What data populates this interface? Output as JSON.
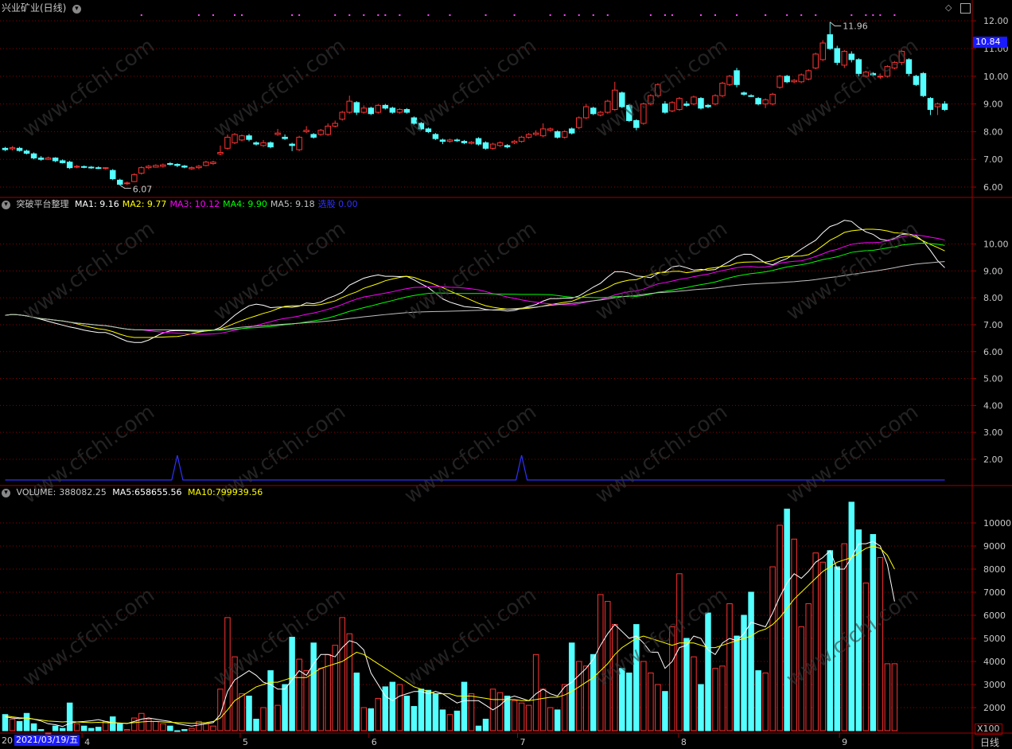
{
  "title": "兴业矿业(日线)",
  "period_label": "日线",
  "x100_label": "X100",
  "colors": {
    "up": "#ff3232",
    "down": "#54ffff",
    "grid": "#8b0000",
    "frame": "#a00000",
    "axis_text": "#c8c8c8",
    "ma1": "#ffffff",
    "ma2": "#ffff00",
    "ma3": "#ff00ff",
    "ma4": "#00ff00",
    "ma5": "#c0c0c0",
    "signal": "#3030ff",
    "dots": "#ff44ff",
    "current_price_bg": "#1a1aff"
  },
  "price_panel": {
    "y_ticks": [
      "12.00",
      "11.00",
      "10.00",
      "9.00",
      "8.00",
      "7.00",
      "6.00"
    ],
    "current_price": "10.84",
    "high_label": "11.96",
    "low_label": "6.07"
  },
  "indicator_panel": {
    "name": "突破平台整理",
    "ma_labels": [
      {
        "name": "MA1:",
        "value": "9.16",
        "color": "#ffffff"
      },
      {
        "name": "MA2:",
        "value": "9.77",
        "color": "#ffff00"
      },
      {
        "name": "MA3:",
        "value": "10.12",
        "color": "#ff00ff"
      },
      {
        "name": "MA4:",
        "value": "9.90",
        "color": "#00ff00"
      },
      {
        "name": "MA5:",
        "value": "9.18",
        "color": "#c0c0c0"
      },
      {
        "name": "选股",
        "value": "0.00",
        "color": "#3030ff"
      }
    ],
    "y_ticks": [
      "10.00",
      "9.00",
      "8.00",
      "7.00",
      "6.00",
      "5.00",
      "4.00",
      "3.00",
      "2.00"
    ]
  },
  "volume_panel": {
    "label": "VOLUME:",
    "value": "388082.25",
    "ma5_label": "MA5:",
    "ma5_value": "658655.56",
    "ma10_label": "MA10:",
    "ma10_value": "799939.56",
    "y_ticks": [
      "10000",
      "9000",
      "8000",
      "7000",
      "6000",
      "5000",
      "4000",
      "3000",
      "2000"
    ]
  },
  "x_axis": {
    "first_date": "2021/03/19/五",
    "prefix": "20",
    "month_labels": [
      "4",
      "5",
      "6",
      "7",
      "8",
      "9"
    ]
  },
  "chart_data": {
    "type": "candlestick",
    "title": "兴业矿业(日线)",
    "price_range": [
      5.8,
      12.35
    ],
    "candles": [
      {
        "o": 7.4,
        "c": 7.35,
        "h": 7.45,
        "l": 7.3
      },
      {
        "o": 7.38,
        "c": 7.42,
        "h": 7.48,
        "l": 7.32
      },
      {
        "o": 7.4,
        "c": 7.32,
        "h": 7.45,
        "l": 7.28
      },
      {
        "o": 7.3,
        "c": 7.22,
        "h": 7.35,
        "l": 7.18
      },
      {
        "o": 7.2,
        "c": 7.05,
        "h": 7.25,
        "l": 7.0
      },
      {
        "o": 7.05,
        "c": 7.0,
        "h": 7.12,
        "l": 6.95
      },
      {
        "o": 7.0,
        "c": 7.05,
        "h": 7.1,
        "l": 6.98
      },
      {
        "o": 7.05,
        "c": 6.95,
        "h": 7.08,
        "l": 6.9
      },
      {
        "o": 6.95,
        "c": 6.88,
        "h": 7.0,
        "l": 6.85
      },
      {
        "o": 6.9,
        "c": 6.7,
        "h": 6.95,
        "l": 6.65
      },
      {
        "o": 6.72,
        "c": 6.75,
        "h": 6.8,
        "l": 6.68
      },
      {
        "o": 6.74,
        "c": 6.72,
        "h": 6.78,
        "l": 6.68
      },
      {
        "o": 6.72,
        "c": 6.7,
        "h": 6.76,
        "l": 6.66
      },
      {
        "o": 6.7,
        "c": 6.68,
        "h": 6.75,
        "l": 6.65
      },
      {
        "o": 6.68,
        "c": 6.7,
        "h": 6.72,
        "l": 6.63
      },
      {
        "o": 6.6,
        "c": 6.3,
        "h": 6.65,
        "l": 6.25
      },
      {
        "o": 6.25,
        "c": 6.1,
        "h": 6.3,
        "l": 6.07
      },
      {
        "o": 6.12,
        "c": 6.15,
        "h": 6.2,
        "l": 6.08
      },
      {
        "o": 6.2,
        "c": 6.45,
        "h": 6.5,
        "l": 6.18
      },
      {
        "o": 6.5,
        "c": 6.7,
        "h": 6.75,
        "l": 6.45
      },
      {
        "o": 6.7,
        "c": 6.75,
        "h": 6.8,
        "l": 6.65
      },
      {
        "o": 6.72,
        "c": 6.78,
        "h": 6.82,
        "l": 6.7
      },
      {
        "o": 6.75,
        "c": 6.8,
        "h": 6.85,
        "l": 6.7
      },
      {
        "o": 6.85,
        "c": 6.82,
        "h": 6.9,
        "l": 6.78
      },
      {
        "o": 6.82,
        "c": 6.78,
        "h": 6.86,
        "l": 6.72
      },
      {
        "o": 6.76,
        "c": 6.72,
        "h": 6.8,
        "l": 6.68
      },
      {
        "o": 6.66,
        "c": 6.7,
        "h": 6.75,
        "l": 6.62
      },
      {
        "o": 6.7,
        "c": 6.75,
        "h": 6.8,
        "l": 6.65
      },
      {
        "o": 6.78,
        "c": 6.9,
        "h": 6.95,
        "l": 6.75
      },
      {
        "o": 6.85,
        "c": 6.9,
        "h": 6.95,
        "l": 6.8
      },
      {
        "o": 7.2,
        "c": 7.25,
        "h": 7.5,
        "l": 7.15
      },
      {
        "o": 7.4,
        "c": 7.8,
        "h": 7.9,
        "l": 7.35
      },
      {
        "o": 7.6,
        "c": 7.9,
        "h": 7.95,
        "l": 7.55
      },
      {
        "o": 7.7,
        "c": 7.85,
        "h": 7.9,
        "l": 7.65
      },
      {
        "o": 7.85,
        "c": 7.72,
        "h": 7.92,
        "l": 7.65
      },
      {
        "o": 7.6,
        "c": 7.55,
        "h": 7.65,
        "l": 7.5
      },
      {
        "o": 7.5,
        "c": 7.6,
        "h": 7.7,
        "l": 7.45
      },
      {
        "o": 7.6,
        "c": 7.45,
        "h": 7.65,
        "l": 7.4
      },
      {
        "o": 7.9,
        "c": 7.95,
        "h": 8.1,
        "l": 7.85
      },
      {
        "o": 7.8,
        "c": 7.75,
        "h": 7.9,
        "l": 7.7
      },
      {
        "o": 7.55,
        "c": 7.5,
        "h": 7.6,
        "l": 7.3
      },
      {
        "o": 7.35,
        "c": 7.8,
        "h": 7.85,
        "l": 7.3
      },
      {
        "o": 8.0,
        "c": 8.05,
        "h": 8.2,
        "l": 7.95
      },
      {
        "o": 7.9,
        "c": 7.8,
        "h": 7.95,
        "l": 7.75
      },
      {
        "o": 7.9,
        "c": 8.05,
        "h": 8.1,
        "l": 7.85
      },
      {
        "o": 7.9,
        "c": 8.2,
        "h": 8.3,
        "l": 7.85
      },
      {
        "o": 8.2,
        "c": 8.3,
        "h": 8.4,
        "l": 8.15
      },
      {
        "o": 8.45,
        "c": 8.7,
        "h": 8.75,
        "l": 8.4
      },
      {
        "o": 8.7,
        "c": 9.1,
        "h": 9.3,
        "l": 8.65
      },
      {
        "o": 9.05,
        "c": 8.7,
        "h": 9.1,
        "l": 8.6
      },
      {
        "o": 8.7,
        "c": 8.85,
        "h": 8.95,
        "l": 8.65
      },
      {
        "o": 8.85,
        "c": 8.65,
        "h": 8.9,
        "l": 8.6
      },
      {
        "o": 8.7,
        "c": 8.95,
        "h": 9.0,
        "l": 8.65
      },
      {
        "o": 8.95,
        "c": 8.85,
        "h": 9.0,
        "l": 8.8
      },
      {
        "o": 8.85,
        "c": 8.7,
        "h": 8.9,
        "l": 8.65
      },
      {
        "o": 8.7,
        "c": 8.8,
        "h": 8.85,
        "l": 8.65
      },
      {
        "o": 8.8,
        "c": 8.7,
        "h": 8.85,
        "l": 8.65
      },
      {
        "o": 8.5,
        "c": 8.3,
        "h": 8.55,
        "l": 8.25
      },
      {
        "o": 8.3,
        "c": 8.1,
        "h": 8.35,
        "l": 8.05
      },
      {
        "o": 8.1,
        "c": 8.0,
        "h": 8.15,
        "l": 7.95
      },
      {
        "o": 7.9,
        "c": 7.75,
        "h": 7.95,
        "l": 7.7
      },
      {
        "o": 7.7,
        "c": 7.65,
        "h": 7.75,
        "l": 7.55
      },
      {
        "o": 7.65,
        "c": 7.7,
        "h": 7.75,
        "l": 7.6
      },
      {
        "o": 7.7,
        "c": 7.68,
        "h": 7.75,
        "l": 7.63
      },
      {
        "o": 7.65,
        "c": 7.6,
        "h": 7.7,
        "l": 7.55
      },
      {
        "o": 7.58,
        "c": 7.62,
        "h": 7.66,
        "l": 7.54
      },
      {
        "o": 7.75,
        "c": 7.55,
        "h": 7.8,
        "l": 7.5
      },
      {
        "o": 7.6,
        "c": 7.4,
        "h": 7.65,
        "l": 7.35
      },
      {
        "o": 7.4,
        "c": 7.55,
        "h": 7.6,
        "l": 7.35
      },
      {
        "o": 7.5,
        "c": 7.6,
        "h": 7.65,
        "l": 7.45
      },
      {
        "o": 7.5,
        "c": 7.45,
        "h": 7.55,
        "l": 7.4
      },
      {
        "o": 7.6,
        "c": 7.65,
        "h": 7.7,
        "l": 7.55
      },
      {
        "o": 7.65,
        "c": 7.8,
        "h": 7.85,
        "l": 7.6
      },
      {
        "o": 7.8,
        "c": 7.9,
        "h": 7.95,
        "l": 7.75
      },
      {
        "o": 7.9,
        "c": 7.95,
        "h": 8.05,
        "l": 7.85
      },
      {
        "o": 7.85,
        "c": 8.1,
        "h": 8.3,
        "l": 7.8
      },
      {
        "o": 8.05,
        "c": 8.1,
        "h": 8.15,
        "l": 8.0
      },
      {
        "o": 8.0,
        "c": 7.8,
        "h": 8.05,
        "l": 7.75
      },
      {
        "o": 7.8,
        "c": 8.0,
        "h": 8.05,
        "l": 7.75
      },
      {
        "o": 8.1,
        "c": 7.95,
        "h": 8.15,
        "l": 7.9
      },
      {
        "o": 8.15,
        "c": 8.5,
        "h": 8.55,
        "l": 8.1
      },
      {
        "o": 8.5,
        "c": 8.9,
        "h": 9.0,
        "l": 8.45
      },
      {
        "o": 8.85,
        "c": 8.65,
        "h": 8.9,
        "l": 8.6
      },
      {
        "o": 8.6,
        "c": 8.7,
        "h": 8.75,
        "l": 8.55
      },
      {
        "o": 8.7,
        "c": 9.1,
        "h": 9.15,
        "l": 8.65
      },
      {
        "o": 8.8,
        "c": 9.5,
        "h": 9.8,
        "l": 8.75
      },
      {
        "o": 9.4,
        "c": 8.9,
        "h": 9.45,
        "l": 8.85
      },
      {
        "o": 8.95,
        "c": 8.4,
        "h": 9.0,
        "l": 8.35
      },
      {
        "o": 8.4,
        "c": 8.15,
        "h": 8.45,
        "l": 8.05
      },
      {
        "o": 8.3,
        "c": 9.0,
        "h": 9.05,
        "l": 8.25
      },
      {
        "o": 9.0,
        "c": 9.3,
        "h": 9.35,
        "l": 8.95
      },
      {
        "o": 9.3,
        "c": 9.7,
        "h": 9.75,
        "l": 9.25
      },
      {
        "o": 9.0,
        "c": 8.7,
        "h": 9.1,
        "l": 8.65
      },
      {
        "o": 8.75,
        "c": 9.05,
        "h": 9.1,
        "l": 8.7
      },
      {
        "o": 8.8,
        "c": 9.2,
        "h": 9.25,
        "l": 8.75
      },
      {
        "o": 9.0,
        "c": 8.95,
        "h": 9.1,
        "l": 8.9
      },
      {
        "o": 9.0,
        "c": 9.25,
        "h": 9.3,
        "l": 8.95
      },
      {
        "o": 9.2,
        "c": 8.85,
        "h": 9.25,
        "l": 8.8
      },
      {
        "o": 8.95,
        "c": 8.9,
        "h": 9.0,
        "l": 8.85
      },
      {
        "o": 9.0,
        "c": 9.3,
        "h": 9.35,
        "l": 8.95
      },
      {
        "o": 9.3,
        "c": 9.75,
        "h": 9.8,
        "l": 9.25
      },
      {
        "o": 9.7,
        "c": 10.0,
        "h": 10.05,
        "l": 9.65
      },
      {
        "o": 10.2,
        "c": 9.7,
        "h": 10.3,
        "l": 9.6
      },
      {
        "o": 9.4,
        "c": 9.35,
        "h": 9.45,
        "l": 9.3
      },
      {
        "o": 9.3,
        "c": 9.28,
        "h": 9.35,
        "l": 9.25
      },
      {
        "o": 9.2,
        "c": 9.0,
        "h": 9.25,
        "l": 8.95
      },
      {
        "o": 9.0,
        "c": 9.15,
        "h": 9.2,
        "l": 8.85
      },
      {
        "o": 9.0,
        "c": 9.35,
        "h": 9.4,
        "l": 8.95
      },
      {
        "o": 9.6,
        "c": 10.0,
        "h": 10.05,
        "l": 9.55
      },
      {
        "o": 10.0,
        "c": 9.8,
        "h": 10.05,
        "l": 9.75
      },
      {
        "o": 9.8,
        "c": 9.85,
        "h": 9.9,
        "l": 9.75
      },
      {
        "o": 9.8,
        "c": 10.05,
        "h": 10.1,
        "l": 9.75
      },
      {
        "o": 9.9,
        "c": 10.2,
        "h": 10.25,
        "l": 9.85
      },
      {
        "o": 10.3,
        "c": 10.8,
        "h": 10.85,
        "l": 10.25
      },
      {
        "o": 10.6,
        "c": 11.2,
        "h": 11.3,
        "l": 10.55
      },
      {
        "o": 11.5,
        "c": 11.0,
        "h": 11.96,
        "l": 10.95
      },
      {
        "o": 11.0,
        "c": 10.5,
        "h": 11.1,
        "l": 10.4
      },
      {
        "o": 10.4,
        "c": 10.9,
        "h": 10.95,
        "l": 10.3
      },
      {
        "o": 10.8,
        "c": 10.6,
        "h": 10.9,
        "l": 10.5
      },
      {
        "o": 10.6,
        "c": 10.1,
        "h": 10.65,
        "l": 10.0
      },
      {
        "o": 10.0,
        "c": 10.15,
        "h": 10.2,
        "l": 9.95
      },
      {
        "o": 10.1,
        "c": 10.05,
        "h": 10.15,
        "l": 10.0
      },
      {
        "o": 10.0,
        "c": 10.0,
        "h": 10.1,
        "l": 9.9
      },
      {
        "o": 10.0,
        "c": 10.35,
        "h": 10.4,
        "l": 9.95
      },
      {
        "o": 10.3,
        "c": 10.5,
        "h": 10.55,
        "l": 10.25
      },
      {
        "o": 10.5,
        "c": 10.9,
        "h": 10.95,
        "l": 10.4
      },
      {
        "o": 10.6,
        "c": 10.1,
        "h": 10.65,
        "l": 10.0
      },
      {
        "o": 10.0,
        "c": 9.7,
        "h": 10.05,
        "l": 9.65
      },
      {
        "o": 10.1,
        "c": 9.3,
        "h": 10.15,
        "l": 9.25
      },
      {
        "o": 9.2,
        "c": 8.8,
        "h": 9.25,
        "l": 8.6
      },
      {
        "o": 8.9,
        "c": 9.0,
        "h": 9.05,
        "l": 8.6
      },
      {
        "o": 9.0,
        "c": 8.8,
        "h": 9.1,
        "l": 8.75
      }
    ],
    "volume_range": [
      1000,
      11000
    ],
    "volumes": [
      1700,
      1500,
      1400,
      1750,
      1300,
      1050,
      900,
      1200,
      1100,
      2200,
      1300,
      1200,
      1100,
      1150,
      1400,
      1600,
      1300,
      1050,
      1550,
      1750,
      1500,
      1400,
      1300,
      1200,
      1000,
      1050,
      1100,
      1400,
      1300,
      1200,
      2800,
      5900,
      4200,
      2600,
      2500,
      1500,
      2000,
      3600,
      2100,
      3000,
      5050,
      4100,
      3600,
      4800,
      3700,
      4300,
      4700,
      5900,
      5200,
      3500,
      2000,
      1950,
      2400,
      2900,
      3100,
      3000,
      2500,
      2050,
      2800,
      2750,
      2600,
      1900,
      1700,
      1850,
      3100,
      2600,
      1200,
      1500,
      2800,
      2650,
      2500,
      2300,
      2200,
      2100,
      4300,
      2800,
      2000,
      1900,
      3000,
      4800,
      4000,
      3800,
      4300,
      6900,
      6600,
      5600,
      3700,
      3500,
      5600,
      4000,
      3500,
      3000,
      2700,
      5500,
      7800,
      5000,
      4200,
      3000,
      6100,
      3700,
      3800,
      6500,
      5100,
      6000,
      7000,
      3600,
      3500,
      8100,
      9900,
      10600,
      9300,
      5500,
      6500,
      8700,
      8300,
      8800,
      8100,
      9100,
      10900,
      9700,
      7400,
      9500,
      8500,
      3900,
      3900
    ],
    "vol_ma5": [
      1600,
      1550,
      1520,
      1560,
      1500,
      1420,
      1300,
      1260,
      1180,
      1320,
      1380,
      1400,
      1430,
      1480,
      1400,
      1350,
      1330,
      1310,
      1400,
      1500,
      1550,
      1500,
      1450,
      1400,
      1300,
      1250,
      1200,
      1250,
      1300,
      1350,
      1700,
      2700,
      3200,
      3400,
      3600,
      3400,
      3100,
      3000,
      2800,
      2800,
      3200,
      3600,
      3400,
      3900,
      4300,
      4300,
      4200,
      4600,
      4900,
      4800,
      4500,
      3500,
      3000,
      2500,
      2300,
      2500,
      2600,
      2700,
      2700,
      2600,
      2700,
      2600,
      2400,
      2200,
      2300,
      2300,
      2300,
      2100,
      1900,
      2100,
      2400,
      2500,
      2400,
      2300,
      2600,
      2800,
      2600,
      2500,
      2900,
      3100,
      3400,
      3700,
      4100,
      4700,
      5200,
      5600,
      5300,
      5000,
      5100,
      4800,
      4400,
      4400,
      3700,
      4000,
      4600,
      4700,
      5100,
      5000,
      4500,
      4300,
      4800,
      5000,
      4900,
      5200,
      5700,
      5600,
      5500,
      6100,
      6800,
      7400,
      7800,
      7600,
      7900,
      8300,
      8500,
      8800,
      8000,
      8000,
      8500,
      9100,
      9100,
      9200,
      9000,
      8200,
      6600
    ],
    "vol_ma10": [
      1650,
      1600,
      1560,
      1540,
      1500,
      1460,
      1420,
      1400,
      1380,
      1400,
      1380,
      1360,
      1350,
      1360,
      1350,
      1340,
      1330,
      1320,
      1350,
      1380,
      1400,
      1400,
      1380,
      1360,
      1350,
      1340,
      1320,
      1330,
      1350,
      1400,
      1550,
      1900,
      2300,
      2500,
      2700,
      2900,
      3000,
      3100,
      3100,
      3200,
      3300,
      3300,
      3300,
      3500,
      3700,
      3800,
      3900,
      4000,
      4200,
      4400,
      4300,
      4100,
      3900,
      3700,
      3500,
      3300,
      3100,
      2900,
      2800,
      2700,
      2600,
      2600,
      2600,
      2500,
      2500,
      2500,
      2450,
      2400,
      2350,
      2350,
      2350,
      2350,
      2300,
      2300,
      2350,
      2400,
      2450,
      2450,
      2550,
      2700,
      2900,
      3100,
      3300,
      3600,
      3900,
      4300,
      4600,
      4800,
      5000,
      5100,
      5000,
      4900,
      4800,
      4700,
      4800,
      4800,
      4800,
      4700,
      4600,
      4600,
      4700,
      4800,
      4900,
      5000,
      5100,
      5300,
      5400,
      5600,
      5900,
      6300,
      6700,
      7000,
      7300,
      7600,
      7900,
      8100,
      8300,
      8400,
      8500,
      8700,
      8900,
      9000,
      8900,
      8600,
      8000
    ]
  }
}
